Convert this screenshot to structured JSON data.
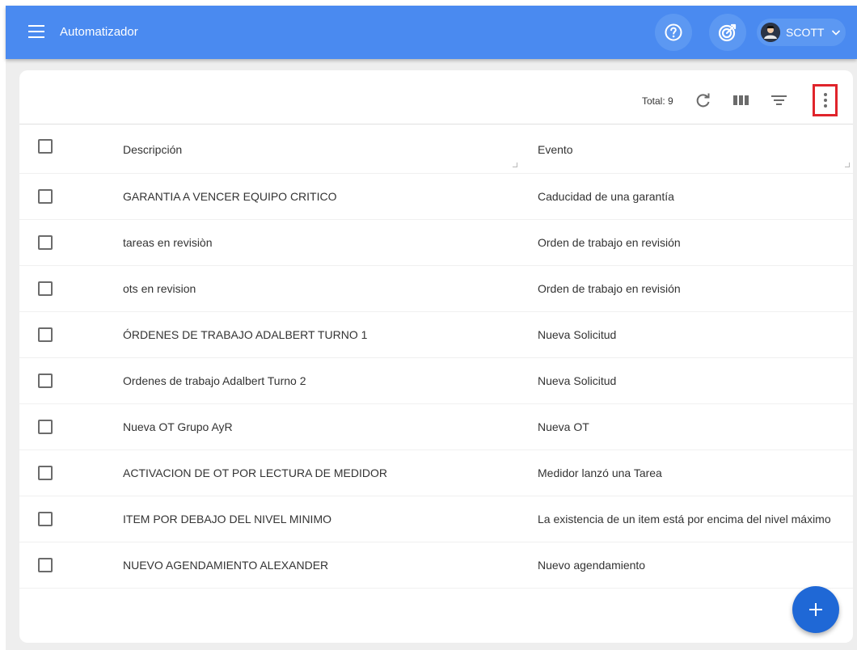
{
  "header": {
    "title": "Automatizador",
    "menu_icon": "hamburger-menu-icon",
    "help_icon": "help-circle-icon",
    "goal_icon": "target-icon",
    "user": {
      "name": "SCOTT",
      "avatar_icon": "user-avatar-icon",
      "chevron_icon": "chevron-down-icon"
    }
  },
  "toolbar": {
    "total_label": "Total: 9",
    "refresh_icon": "refresh-icon",
    "columns_icon": "view-columns-icon",
    "filter_icon": "filter-icon",
    "more_icon": "more-vert-icon"
  },
  "table": {
    "columns": [
      "Descripción",
      "Evento"
    ],
    "rows": [
      {
        "description": "GARANTIA A VENCER EQUIPO CRITICO",
        "event": "Caducidad de una garantía"
      },
      {
        "description": "tareas en revisiòn",
        "event": "Orden de trabajo en revisión"
      },
      {
        "description": "ots en revision",
        "event": "Orden de trabajo en revisión"
      },
      {
        "description": "ÓRDENES DE TRABAJO ADALBERT TURNO 1",
        "event": "Nueva Solicitud"
      },
      {
        "description": "Ordenes de trabajo Adalbert Turno 2",
        "event": "Nueva Solicitud"
      },
      {
        "description": "Nueva OT Grupo AyR",
        "event": "Nueva OT"
      },
      {
        "description": "ACTIVACION DE OT POR LECTURA DE MEDIDOR",
        "event": "Medidor lanzó una Tarea"
      },
      {
        "description": "ITEM POR DEBAJO DEL NIVEL MINIMO",
        "event": "La existencia de un item está por encima del nivel máximo"
      },
      {
        "description": "NUEVO AGENDAMIENTO ALEXANDER",
        "event": "Nuevo agendamiento"
      }
    ]
  },
  "fab": {
    "icon": "add-icon"
  },
  "colors": {
    "header_bg": "#4a8af0",
    "fab_bg": "#1f68d6",
    "highlight_border": "#e0242b"
  }
}
